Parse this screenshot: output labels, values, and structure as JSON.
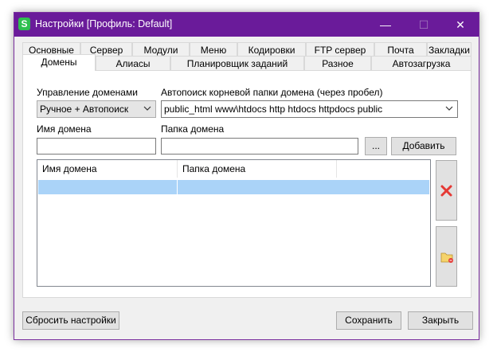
{
  "window": {
    "title": "Настройки [Профиль: Default]",
    "app_icon_letter": "S",
    "minimize_glyph": "—",
    "maximize_glyph": "☐",
    "close_glyph": "✕"
  },
  "tabs_row1": [
    "Основные",
    "Сервер",
    "Модули",
    "Меню",
    "Кодировки",
    "FTP сервер",
    "Почта",
    "Закладки"
  ],
  "tabs_row2": [
    "Домены",
    "Алиасы",
    "Планировщик заданий",
    "Разное",
    "Автозагрузка"
  ],
  "active_tab": "Домены",
  "domains": {
    "management_label": "Управление доменами",
    "management_value": "Ручное + Автопоиск",
    "autosearch_label": "Автопоиск корневой папки домена (через пробел)",
    "autosearch_value": "public_html www\\htdocs http htdocs httpdocs public",
    "domain_name_label": "Имя домена",
    "domain_name_value": "",
    "domain_folder_label": "Папка домена",
    "domain_folder_value": "",
    "browse_label": "...",
    "add_label": "Добавить",
    "table": {
      "columns": [
        "Имя домена",
        "Папка домена"
      ],
      "rows": [
        [
          "",
          ""
        ]
      ]
    }
  },
  "footer": {
    "reset_label": "Сбросить настройки",
    "save_label": "Сохранить",
    "close_label": "Закрыть"
  },
  "colors": {
    "titlebar": "#6a1b9a",
    "selection": "#aad3f8",
    "delete_icon": "#e53935"
  }
}
